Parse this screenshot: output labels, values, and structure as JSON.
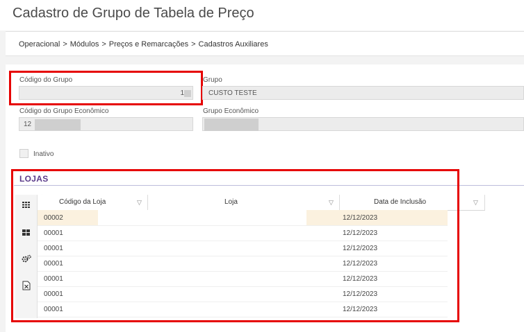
{
  "page": {
    "title": "Cadastro de Grupo de Tabela de Preço"
  },
  "breadcrumb": [
    "Operacional",
    "Módulos",
    "Preços e Remarcações",
    "Cadastros Auxiliares"
  ],
  "breadcrumb_separator": ">",
  "form": {
    "codigo_grupo": {
      "label": "Código do Grupo",
      "value": "1"
    },
    "grupo": {
      "label": "Grupo",
      "value": "CUSTO TESTE"
    },
    "codigo_grupo_economico": {
      "label": "Código do Grupo Econômico",
      "value": "12"
    },
    "grupo_economico": {
      "label": "Grupo Econômico",
      "value": ""
    },
    "inativo": {
      "label": "Inativo",
      "checked": false
    }
  },
  "lojas": {
    "title": "LOJAS",
    "columns": [
      "Código da Loja",
      "Loja",
      "Data de Inclusão"
    ],
    "rows": [
      {
        "codigo": "00002",
        "loja": "",
        "data": "12/12/2023"
      },
      {
        "codigo": "00001",
        "loja": "",
        "data": "12/12/2023"
      },
      {
        "codigo": "00001",
        "loja": "",
        "data": "12/12/2023"
      },
      {
        "codigo": "00001",
        "loja": "",
        "data": "12/12/2023"
      },
      {
        "codigo": "00001",
        "loja": "",
        "data": "12/12/2023"
      },
      {
        "codigo": "00001",
        "loja": "",
        "data": "12/12/2023"
      },
      {
        "codigo": "00001",
        "loja": "",
        "data": "12/12/2023"
      }
    ],
    "toolbar_icons": [
      "grid-view-icon",
      "card-view-icon",
      "settings-icon",
      "excel-export-icon"
    ]
  },
  "colors": {
    "highlight": "#e60000",
    "section_title": "#5a3a8a",
    "selected_row": "#fbf1df"
  }
}
